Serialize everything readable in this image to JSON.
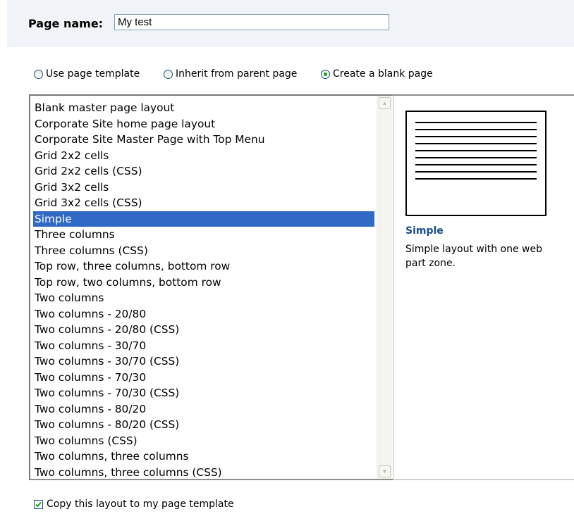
{
  "page_name": {
    "label": "Page name:",
    "value": "My test"
  },
  "mode_options": [
    {
      "label": "Use page template",
      "selected": false
    },
    {
      "label": "Inherit from parent page",
      "selected": false
    },
    {
      "label": "Create a blank page",
      "selected": true
    }
  ],
  "layouts": [
    "Blank master page layout",
    "Corporate Site home page layout",
    "Corporate Site Master Page with Top Menu",
    "Grid 2x2 cells",
    "Grid 2x2 cells (CSS)",
    "Grid 3x2 cells",
    "Grid 3x2 cells (CSS)",
    "Simple",
    "Three columns",
    "Three columns (CSS)",
    "Top row, three columns, bottom row",
    "Top row, two columns, bottom row",
    "Two columns",
    "Two columns - 20/80",
    "Two columns - 20/80 (CSS)",
    "Two columns - 30/70",
    "Two columns - 30/70 (CSS)",
    "Two columns - 70/30",
    "Two columns - 70/30 (CSS)",
    "Two columns - 80/20",
    "Two columns - 80/20 (CSS)",
    "Two columns (CSS)",
    "Two columns, three columns",
    "Two columns, three columns (CSS)"
  ],
  "selected_layout": "Simple",
  "preview": {
    "title": "Simple",
    "description": "Simple layout with one web part zone."
  },
  "copy_option": {
    "label": "Copy this layout to my page template",
    "checked": true
  },
  "colors": {
    "selection": "#316ac5",
    "preview_title": "#1a4d8f",
    "radio_dot": "#21a121"
  }
}
